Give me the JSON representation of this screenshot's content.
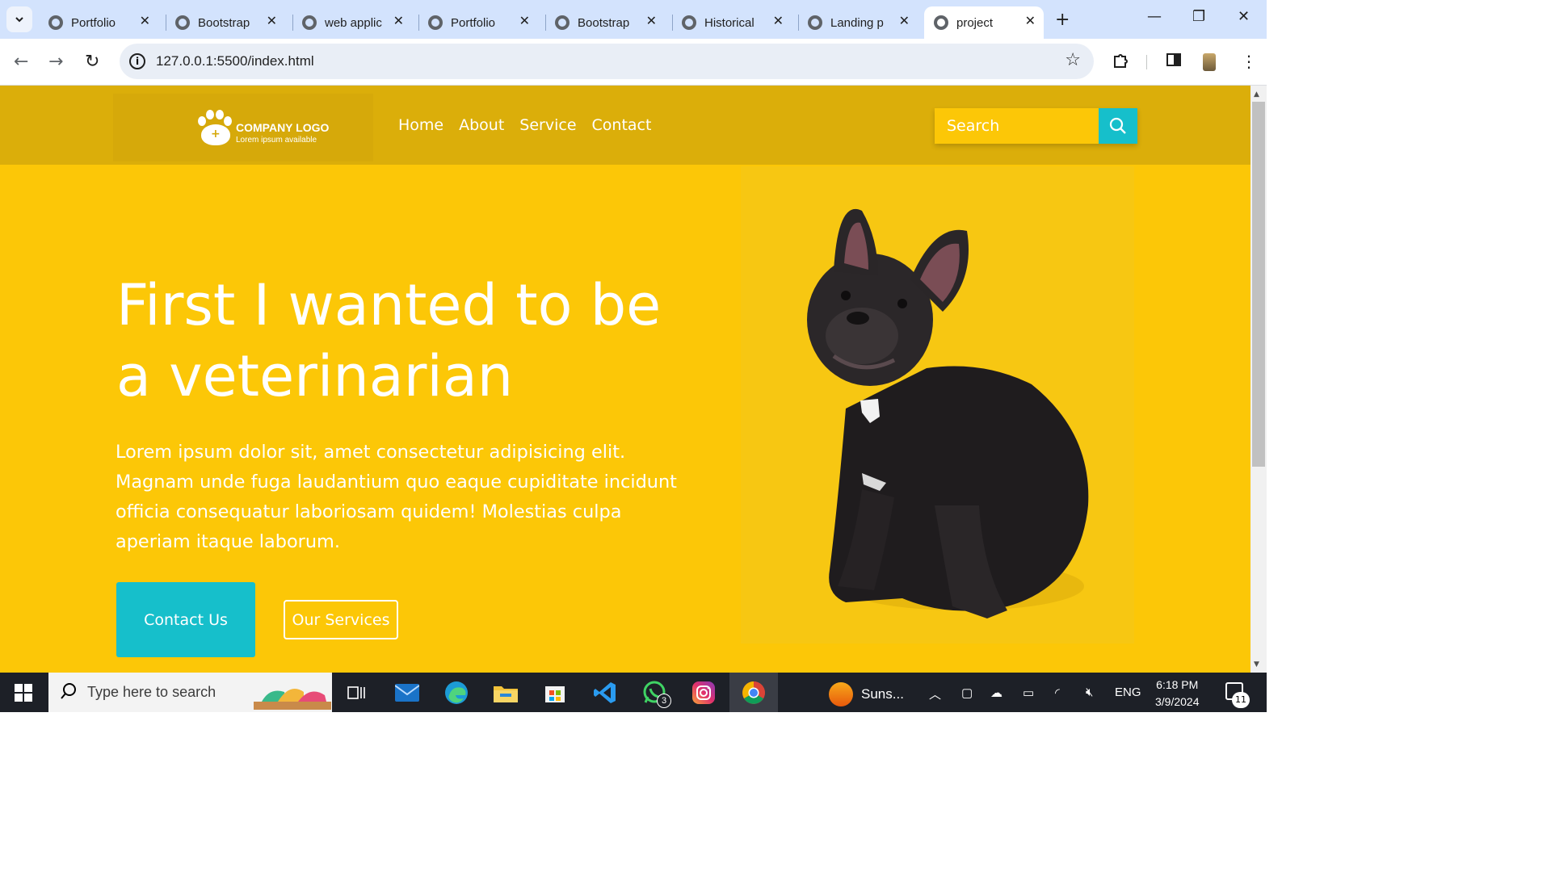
{
  "browser": {
    "tabs": [
      {
        "title": "Portfolio",
        "active": false
      },
      {
        "title": "Bootstrap",
        "active": false
      },
      {
        "title": "web applic",
        "active": false
      },
      {
        "title": "Portfolio",
        "active": false
      },
      {
        "title": "Bootstrap",
        "active": false
      },
      {
        "title": "Historical",
        "active": false
      },
      {
        "title": "Landing p",
        "active": false
      },
      {
        "title": "project",
        "active": true
      }
    ],
    "url": "127.0.0.1:5500/index.html"
  },
  "site": {
    "logo": {
      "title": "COMPANY LOGO",
      "subtitle": "Lorem ipsum available"
    },
    "nav": [
      "Home",
      "About",
      "Service",
      "Contact"
    ],
    "search": {
      "placeholder": "Search"
    },
    "hero": {
      "title_line1": "First I wanted to be",
      "title_line2": "a veterinarian",
      "text": "Lorem ipsum dolor sit, amet consectetur adipisicing elit. Magnam unde fuga laudantium quo eaque cupiditate incidunt officia consequatur laboriosam quidem! Molestias culpa aperiam itaque laborum.",
      "primary_button": "Contact Us",
      "secondary_button": "Our Services"
    },
    "colors": {
      "primary": "#fcc707",
      "header": "#dbae0a",
      "accent": "#16bfcb",
      "text": "#ffffff"
    }
  },
  "taskbar": {
    "search_placeholder": "Type here to search",
    "weather": "Suns...",
    "language": "ENG",
    "time": "6:18 PM",
    "date": "3/9/2024",
    "whatsapp_badge": "3",
    "notification_count": "11"
  }
}
